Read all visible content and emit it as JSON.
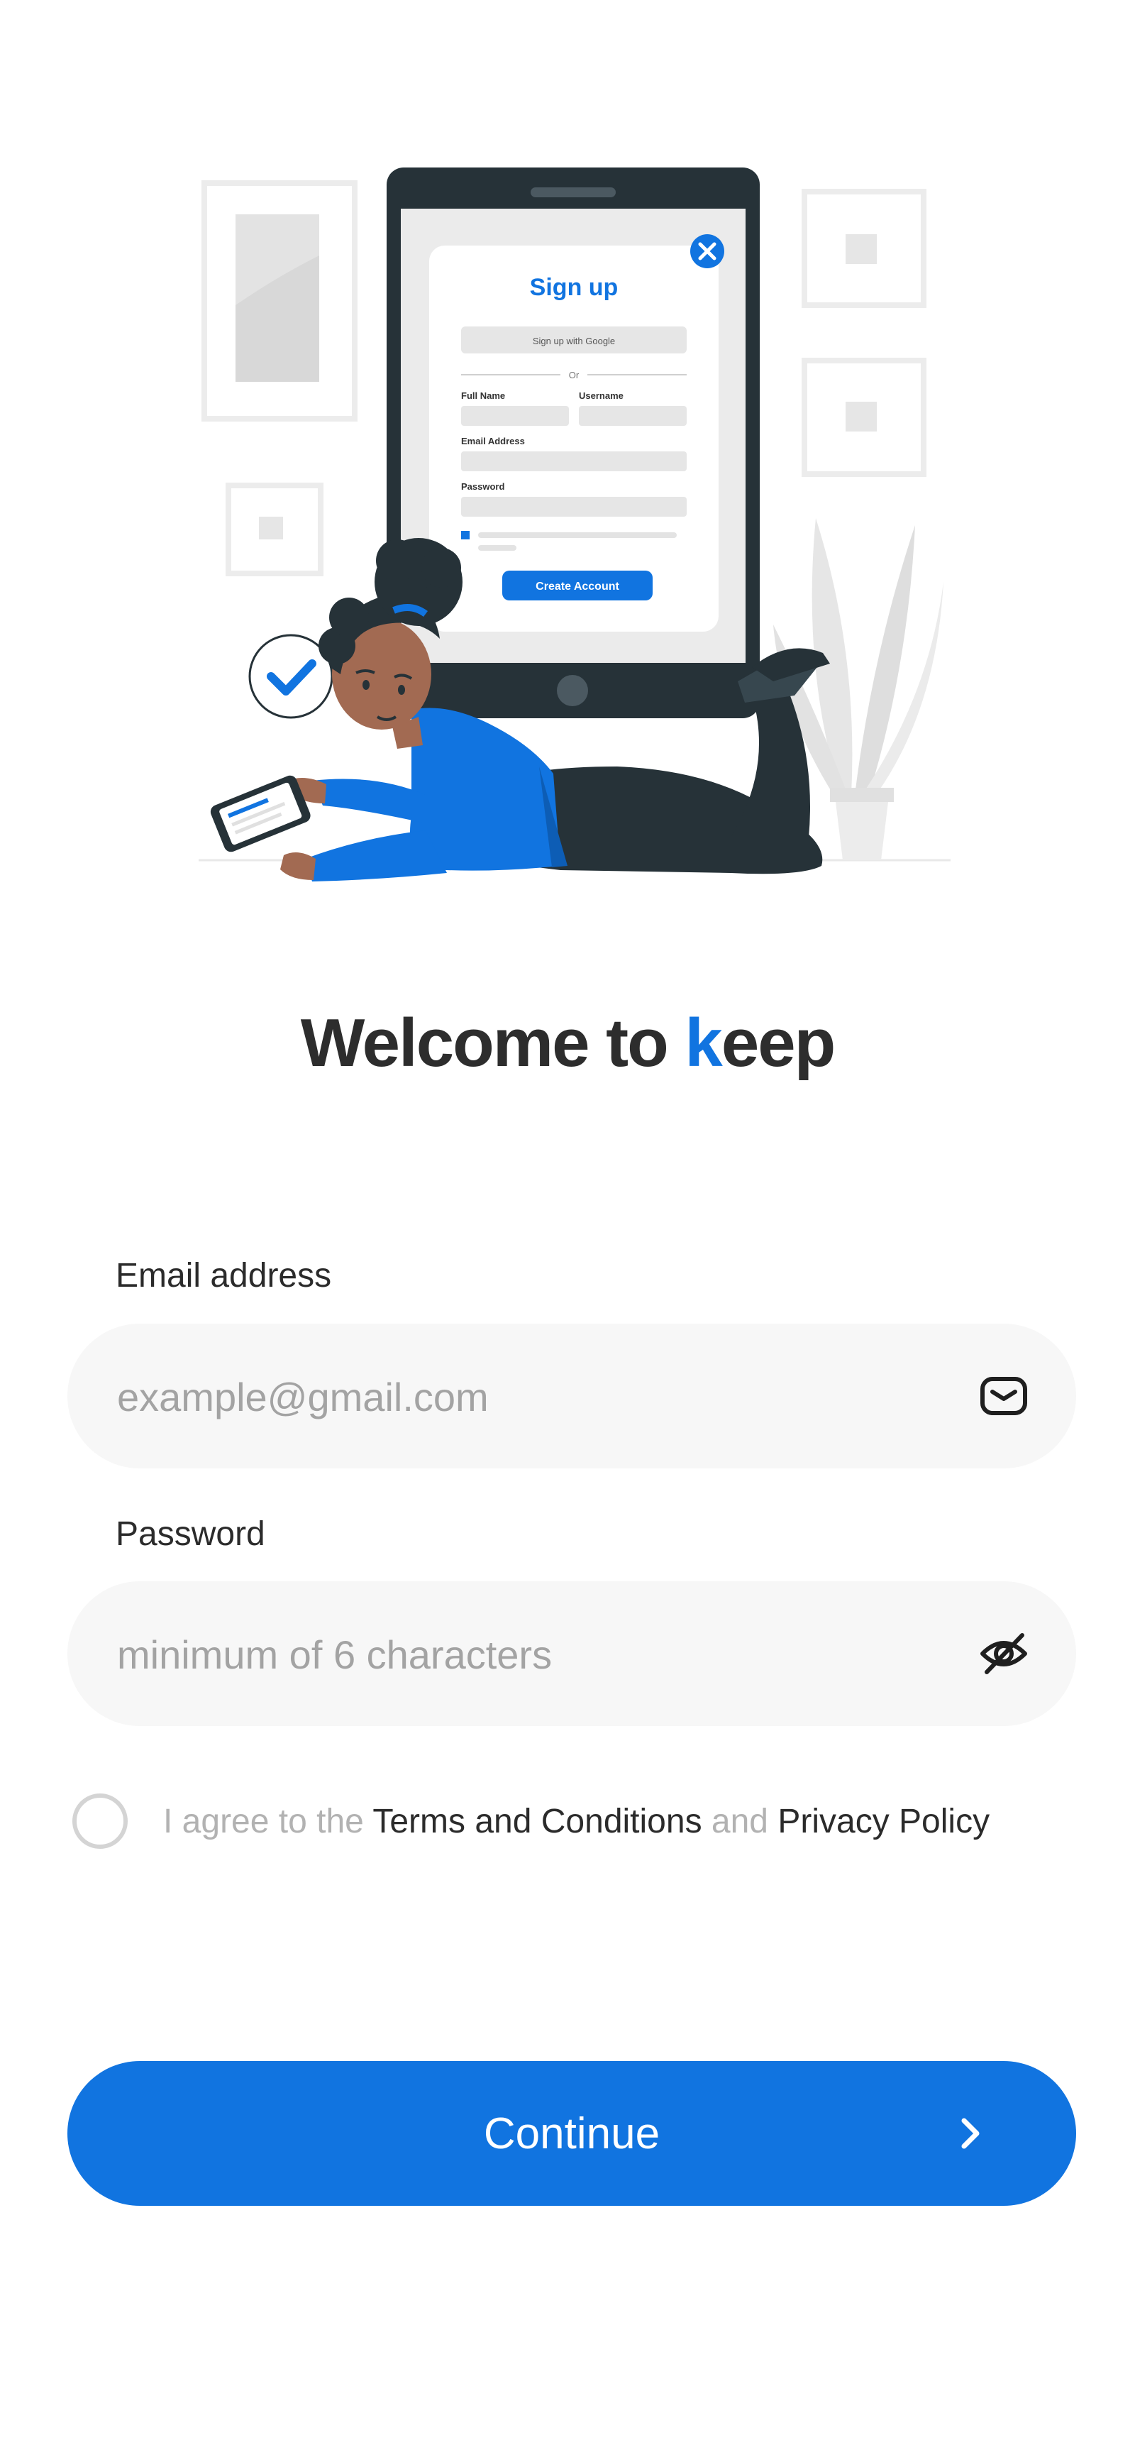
{
  "illustration": {
    "card_title": "Sign up",
    "google_button": "Sign up with Google",
    "divider": "Or",
    "full_name": "Full Name",
    "username": "Username",
    "email": "Email Address",
    "password": "Password",
    "create_button": "Create Account"
  },
  "welcome": {
    "prefix": "Welcome to ",
    "brand_k": "k",
    "brand_rest": "eep"
  },
  "email": {
    "label": "Email address",
    "placeholder": "example@gmail.com",
    "icon": "mail-icon"
  },
  "password": {
    "label": "Password",
    "placeholder": "minimum of 6 characters",
    "icon": "eye-off-icon"
  },
  "agreement": {
    "text_1": "I agree to the ",
    "terms": "Terms and Conditions",
    "text_2": " and ",
    "privacy": "Privacy Policy",
    "checked": false
  },
  "continue_button": {
    "label": "Continue",
    "icon": "chevron-right-icon"
  },
  "colors": {
    "accent": "#1174e0",
    "field_bg": "#f7f7f7",
    "text": "#2b2b2b",
    "muted": "#a3a3a3"
  }
}
